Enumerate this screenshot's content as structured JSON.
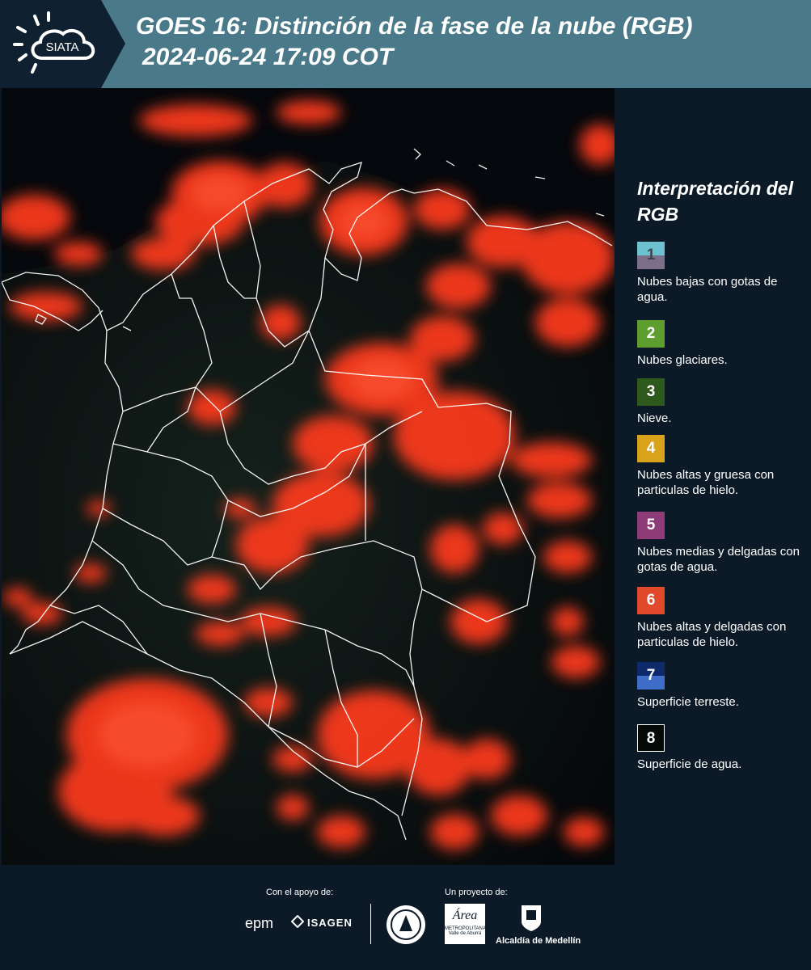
{
  "header": {
    "logo_text": "SIATA",
    "title_line1": "GOES 16: Distinción de la fase de la nube (RGB)",
    "title_line2": "2024-06-24 17:09 COT"
  },
  "legend": {
    "title": "Interpretación del RGB",
    "items": [
      {
        "num": "1",
        "label": "Nubes bajas con gotas de agua.",
        "color": "#6cc3cf"
      },
      {
        "num": "2",
        "label": "Nubes glaciares.",
        "color": "#5e9e2e"
      },
      {
        "num": "3",
        "label": "Nieve.",
        "color": "#2d5a1c"
      },
      {
        "num": "4",
        "label": "Nubes altas y gruesa con particulas de hielo.",
        "color": "#d8a21a"
      },
      {
        "num": "5",
        "label": "Nubes medias y delgadas con gotas de agua.",
        "color": "#8e3c78"
      },
      {
        "num": "6",
        "label": "Nubes altas y delgadas con particulas de hielo.",
        "color": "#e04a2a"
      },
      {
        "num": "7",
        "label": "Superficie terreste.",
        "color": "#1c3a8a"
      },
      {
        "num": "8",
        "label": "Superficie de agua.",
        "color": "#050a08"
      }
    ]
  },
  "footer": {
    "support_label": "Con el apoyo de:",
    "project_label": "Un proyecto de:",
    "brand_epm": "epm",
    "brand_isagen": "ISAGEN",
    "brand_area_main": "Área",
    "brand_area_sub1": "METROPOLITANA",
    "brand_area_sub2": "Valle de Aburrá",
    "brand_medellin": "Alcaldía de Medellín"
  }
}
